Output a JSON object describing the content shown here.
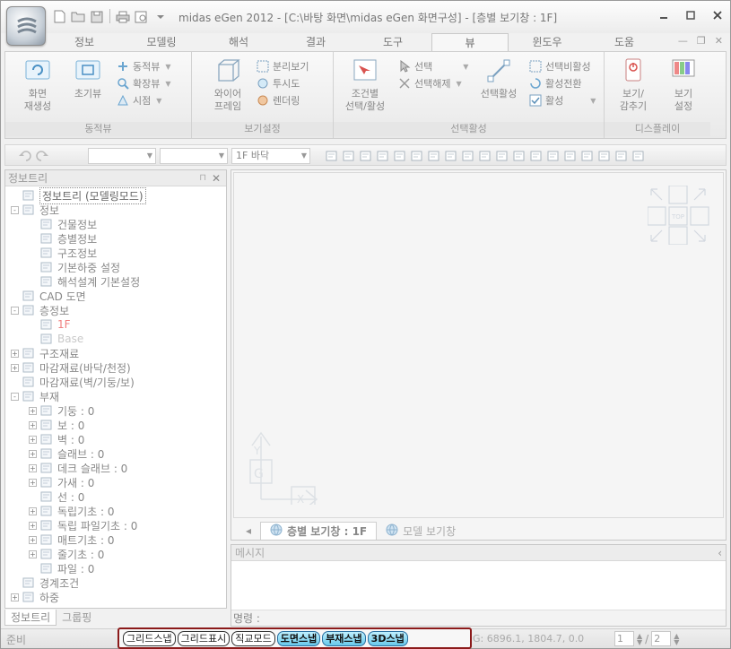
{
  "window": {
    "title": "midas eGen  2012 - [C:\\바탕 화면\\midas eGen 화면구성] - [층별 보기창 : 1F]"
  },
  "ribbon_tabs": [
    "정보",
    "모델링",
    "해석",
    "결과",
    "도구",
    "뷰",
    "윈도우",
    "도움"
  ],
  "active_tab_index": 5,
  "ribbon": {
    "group_dynamic": {
      "label": "동적뷰",
      "regen": "화면\n재생성",
      "init_view": "초기뷰",
      "dynamic_view": "동적뷰",
      "zoom_view": "확장뷰",
      "viewpoint": "시점"
    },
    "group_view_settings": {
      "label": "보기설정",
      "wireframe": "와이어\n프레임",
      "separate_view": "분리보기",
      "transparency": "투시도",
      "rendering": "렌더링"
    },
    "group_select": {
      "label": "선택활성",
      "conditional": "조건별\n선택/활성",
      "select": "선택",
      "deselect": "선택해제",
      "active_select": "선택활성",
      "select_inactive": "선택비활성",
      "toggle_active": "활성전환",
      "activate": "활성"
    },
    "group_display": {
      "label": "디스플레이",
      "show_hide": "보기/\n감추기",
      "view_settings": "보기\n설정"
    }
  },
  "toolbar2": {
    "story_combo": "1F 바닥"
  },
  "tree_panel": {
    "title": "정보트리",
    "nodes": [
      {
        "level": 0,
        "exp": "",
        "icon": "tree-root-icon",
        "label": "정보트리 (모델링모드)",
        "style": "root"
      },
      {
        "level": 0,
        "exp": "-",
        "icon": "building-info-icon",
        "label": "정보",
        "style": ""
      },
      {
        "level": 1,
        "exp": "",
        "icon": "building-icon",
        "label": "건물정보",
        "style": ""
      },
      {
        "level": 1,
        "exp": "",
        "icon": "story-info-icon",
        "label": "층별정보",
        "style": ""
      },
      {
        "level": 1,
        "exp": "",
        "icon": "structure-info-icon",
        "label": "구조정보",
        "style": ""
      },
      {
        "level": 1,
        "exp": "",
        "icon": "load-setting-icon",
        "label": "기본하중 설정",
        "style": ""
      },
      {
        "level": 1,
        "exp": "",
        "icon": "analysis-design-icon",
        "label": "해석설계 기본설정",
        "style": ""
      },
      {
        "level": 0,
        "exp": "",
        "icon": "cad-drawing-icon",
        "label": "CAD 도면",
        "style": ""
      },
      {
        "level": 0,
        "exp": "-",
        "icon": "story-icon",
        "label": "층정보",
        "style": ""
      },
      {
        "level": 1,
        "exp": "",
        "icon": "floor-icon",
        "label": "1F",
        "style": "red"
      },
      {
        "level": 1,
        "exp": "",
        "icon": "base-floor-icon",
        "label": "Base",
        "style": "faint"
      },
      {
        "level": 0,
        "exp": "+",
        "icon": "material-icon",
        "label": "구조재료",
        "style": ""
      },
      {
        "level": 0,
        "exp": "+",
        "icon": "finish-floor-icon",
        "label": "마감재료(바닥/천정)",
        "style": ""
      },
      {
        "level": 0,
        "exp": "",
        "icon": "finish-wall-icon",
        "label": "마감재료(벽/기둥/보)",
        "style": ""
      },
      {
        "level": 0,
        "exp": "-",
        "icon": "member-icon",
        "label": "부재",
        "style": ""
      },
      {
        "level": 1,
        "exp": "+",
        "icon": "column-icon",
        "label": "기둥 : 0",
        "style": ""
      },
      {
        "level": 1,
        "exp": "+",
        "icon": "beam-icon",
        "label": "보 : 0",
        "style": ""
      },
      {
        "level": 1,
        "exp": "+",
        "icon": "wall-icon",
        "label": "벽 : 0",
        "style": ""
      },
      {
        "level": 1,
        "exp": "+",
        "icon": "slab-icon",
        "label": "슬래브 : 0",
        "style": ""
      },
      {
        "level": 1,
        "exp": "+",
        "icon": "deck-slab-icon",
        "label": "데크 슬래브 : 0",
        "style": ""
      },
      {
        "level": 1,
        "exp": "+",
        "icon": "brace-icon",
        "label": "가새 : 0",
        "style": ""
      },
      {
        "level": 1,
        "exp": "",
        "icon": "line-icon",
        "label": "선 : 0",
        "style": ""
      },
      {
        "level": 1,
        "exp": "+",
        "icon": "footing-icon",
        "label": "독립기초 : 0",
        "style": ""
      },
      {
        "level": 1,
        "exp": "+",
        "icon": "pile-footing-icon",
        "label": "독립 파일기초 : 0",
        "style": ""
      },
      {
        "level": 1,
        "exp": "+",
        "icon": "mat-footing-icon",
        "label": "매트기초 : 0",
        "style": ""
      },
      {
        "level": 1,
        "exp": "+",
        "icon": "strip-footing-icon",
        "label": "줄기초 : 0",
        "style": ""
      },
      {
        "level": 1,
        "exp": "",
        "icon": "pile-icon",
        "label": "파일 : 0",
        "style": ""
      },
      {
        "level": 0,
        "exp": "",
        "icon": "boundary-icon",
        "label": "경계조건",
        "style": ""
      },
      {
        "level": 0,
        "exp": "+",
        "icon": "load-icon",
        "label": "하중",
        "style": ""
      }
    ],
    "tabs": [
      "정보트리",
      "그룹핑"
    ]
  },
  "view": {
    "tabs": [
      {
        "label": "층별 보기창 : 1F",
        "active": true
      },
      {
        "label": "모델 보기창",
        "active": false
      }
    ]
  },
  "message": {
    "title": "메시지",
    "command_label": "명령 :"
  },
  "status": {
    "ready": "준비",
    "snaps": [
      {
        "label": "그리드스냅",
        "on": false
      },
      {
        "label": "그리드표시",
        "on": false
      },
      {
        "label": "직교모드",
        "on": false
      },
      {
        "label": "도면스냅",
        "on": true
      },
      {
        "label": "부재스냅",
        "on": true
      },
      {
        "label": "3D스냅",
        "on": true
      }
    ],
    "coords": "G: 6896.1, 1804.7, 0.0",
    "page_current": "1",
    "page_sep": "/",
    "page_total": "2"
  }
}
